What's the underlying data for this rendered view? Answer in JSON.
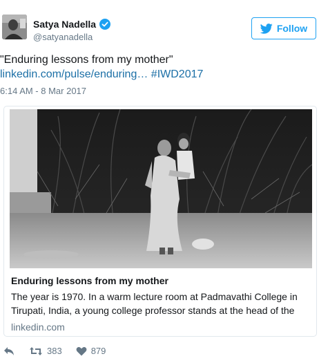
{
  "author": {
    "name": "Satya Nadella",
    "handle": "@satyanadella",
    "verified": true
  },
  "follow_button": {
    "label": "Follow",
    "icon": "twitter-bird-icon"
  },
  "tweet": {
    "text_line1": "\"Enduring lessons from my mother\"",
    "link_text": "linkedin.com/pulse/enduring…",
    "hashtag": "#IWD2017",
    "timestamp": "6:14 AM - 8 Mar 2017"
  },
  "card": {
    "title": "Enduring lessons from my mother",
    "description_line1": "The year is 1970. In a warm lecture room at Padmavathi College in",
    "description_line2": "Tirupati, India, a young college professor stands at the head of the",
    "domain": "linkedin.com"
  },
  "actions": {
    "retweet_count": "383",
    "like_count": "879"
  },
  "colors": {
    "accent": "#1da1f2",
    "link": "#1b6fa6",
    "muted": "#657786"
  }
}
